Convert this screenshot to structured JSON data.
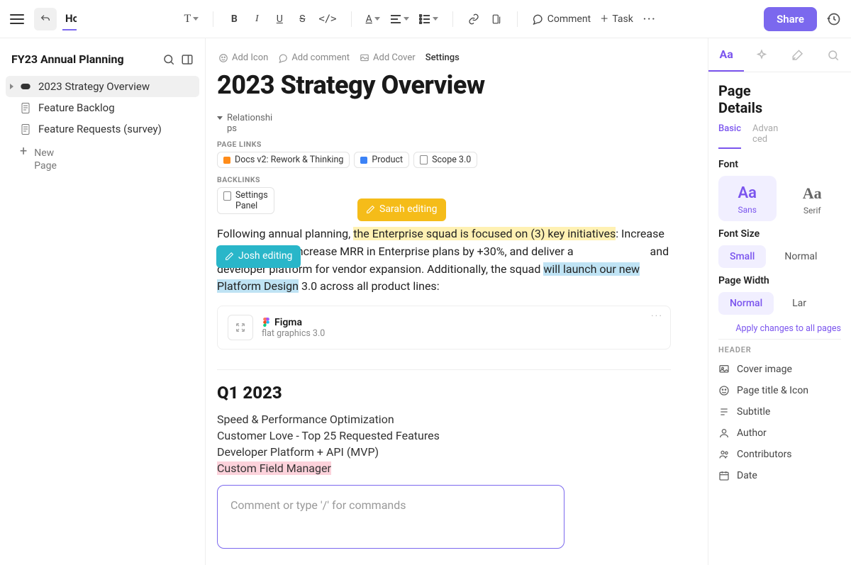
{
  "topbar": {
    "btn_comment": "Comment",
    "btn_task": "Task",
    "btn_share": "Share",
    "home_label": "Ho"
  },
  "sidebar": {
    "workspace_title": "FY23 Annual Planning",
    "items": [
      {
        "label": "2023 Strategy Overview",
        "active": true,
        "icon": "controller"
      },
      {
        "label": "Feature Backlog",
        "active": false,
        "icon": "doc"
      },
      {
        "label": "Feature Requests (survey)",
        "active": false,
        "icon": "doc"
      }
    ],
    "new_page_l1": "New",
    "new_page_l2": "Page"
  },
  "main": {
    "meta": {
      "add_icon": "Add Icon",
      "add_comment": "Add comment",
      "add_cover": "Add Cover",
      "settings": "Settings"
    },
    "title": "2023 Strategy Overview",
    "relationships_label": "Relationships",
    "page_links_label": "PAGE LINKS",
    "backlinks_label": "BACKLINKS",
    "page_links": [
      {
        "label": "Docs v2: Rework & Thinking",
        "color": "orange"
      },
      {
        "label": "Product",
        "color": "blue"
      },
      {
        "label": "Scope 3.0",
        "color": "doc"
      }
    ],
    "backlinks": [
      {
        "label_l1": "Settings",
        "label_l2": "Panel"
      }
    ],
    "paragraph": {
      "pre": "Following annual planning, ",
      "hl1": "the Enterprise squad is focused on (3) key initiatives",
      "mid1": ": Increase CSAT by +25%, increase MRR in Enterprise plans by +30%, and deliver a ",
      "mid2_gap": " and developer platform for vendor expansion. Additionally, the squad ",
      "hl2": "will launch our new Platform Design",
      "post": " 3.0 across all product lines:"
    },
    "collab": {
      "sarah": "Sarah editing",
      "josh": "Josh editing"
    },
    "embed": {
      "name": "Figma",
      "subtitle": "flat graphics 3.0"
    },
    "q1_heading": "Q1 2023",
    "q1_items": [
      "Speed & Performance Optimization",
      "Customer Love - Top 25 Requested Features",
      "Developer Platform + API (MVP)",
      "Custom Field Manager"
    ],
    "comment_placeholder": "Comment or type '/' for commands"
  },
  "rightpanel": {
    "title_l1": "Page",
    "title_l2": "Details",
    "tab_basic": "Basic",
    "tab_advanced": "Advanced",
    "font_label": "Font",
    "font_sans": "Sans",
    "font_serif": "Serif",
    "font_Aa": "Aa",
    "font_size_label": "Font Size",
    "size_small": "Small",
    "size_normal": "Normal",
    "page_width_label": "Page Width",
    "width_normal": "Normal",
    "width_large": "Lar",
    "apply_all": "Apply changes to all pages",
    "header_label": "HEADER",
    "header_rows": [
      "Cover image",
      "Page title & Icon",
      "Subtitle",
      "Author",
      "Contributors",
      "Date"
    ]
  }
}
